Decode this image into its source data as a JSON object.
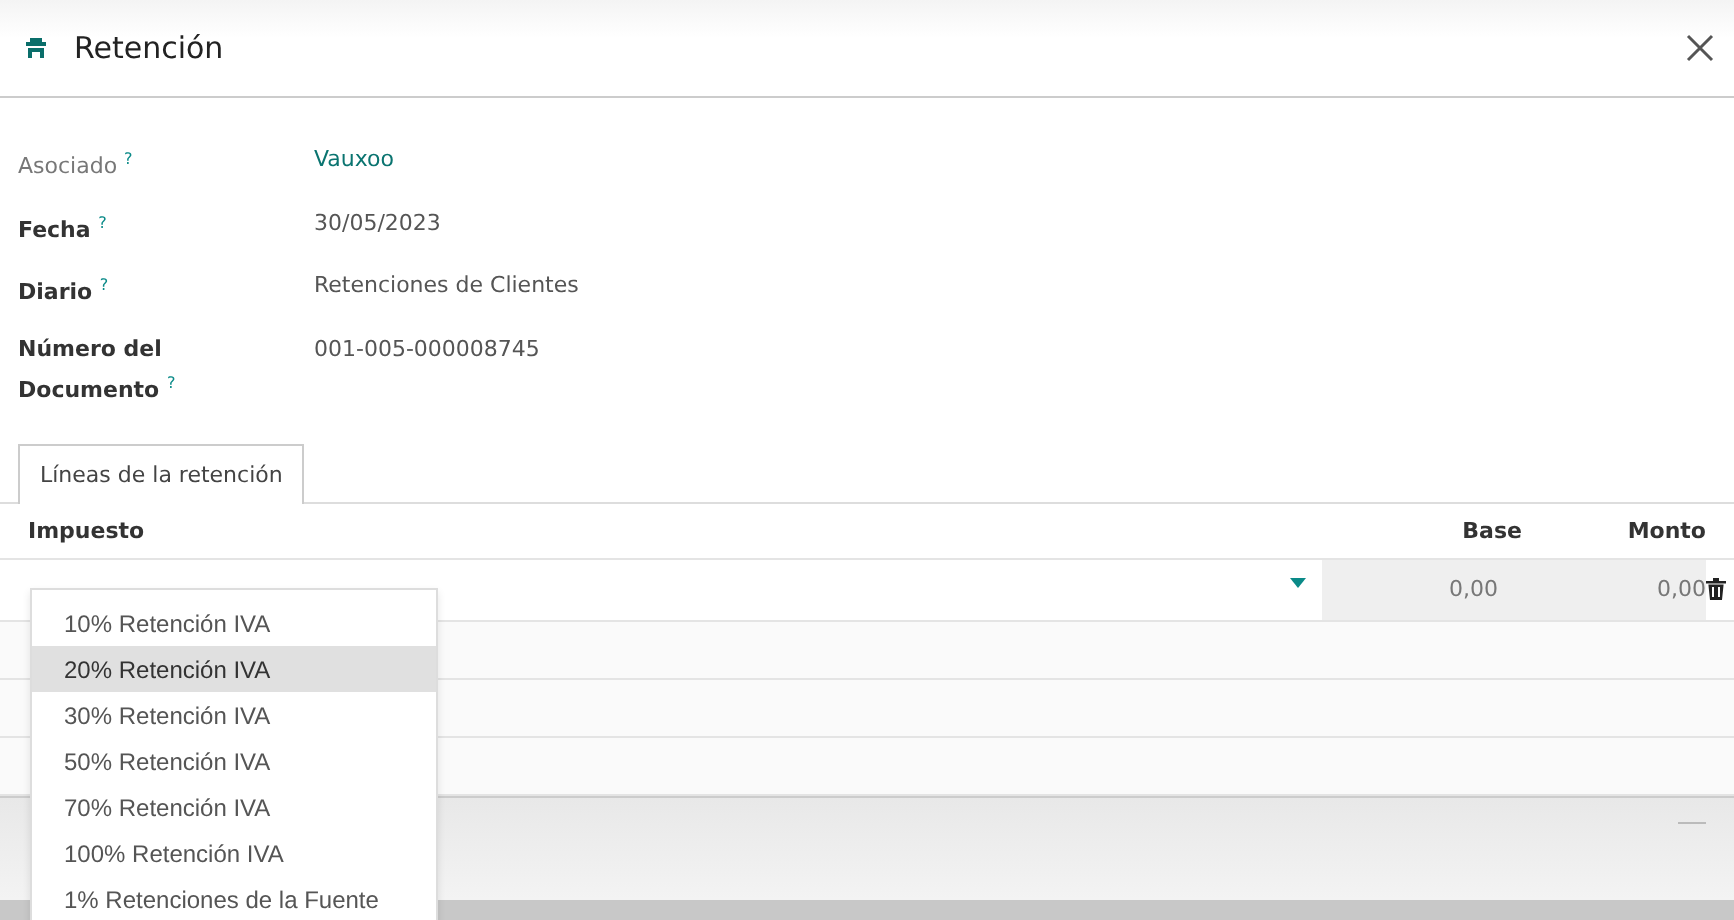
{
  "window": {
    "title": "Retención"
  },
  "fields": [
    {
      "label": "Asociado",
      "help": "?",
      "value": "Vauxoo",
      "kind": "link"
    },
    {
      "label": "Fecha",
      "help": "?",
      "value": "30/05/2023",
      "kind": "text"
    },
    {
      "label": "Diario",
      "help": "?",
      "value": "Retenciones de Clientes",
      "kind": "text"
    },
    {
      "label": "Número del Documento",
      "help": "?",
      "value": "001-005-000008745",
      "kind": "text"
    }
  ],
  "tabs": [
    {
      "label": "Líneas de la retención",
      "selected": true
    }
  ],
  "table": {
    "columns": [
      "Impuesto",
      "Base",
      "Monto"
    ],
    "rows": [
      {
        "base": "0,00",
        "monto": "0,00"
      }
    ]
  },
  "dropdown": [
    {
      "label": "10% Retención IVA",
      "selected": false
    },
    {
      "label": "20% Retención IVA",
      "selected": true
    },
    {
      "label": "30% Retención IVA",
      "selected": false
    },
    {
      "label": "50% Retención IVA",
      "selected": false
    },
    {
      "label": "70% Retención IVA",
      "selected": false
    },
    {
      "label": "100% Retención IVA",
      "selected": false
    },
    {
      "label": "1% Retenciones de la Fuente",
      "selected": false
    }
  ]
}
